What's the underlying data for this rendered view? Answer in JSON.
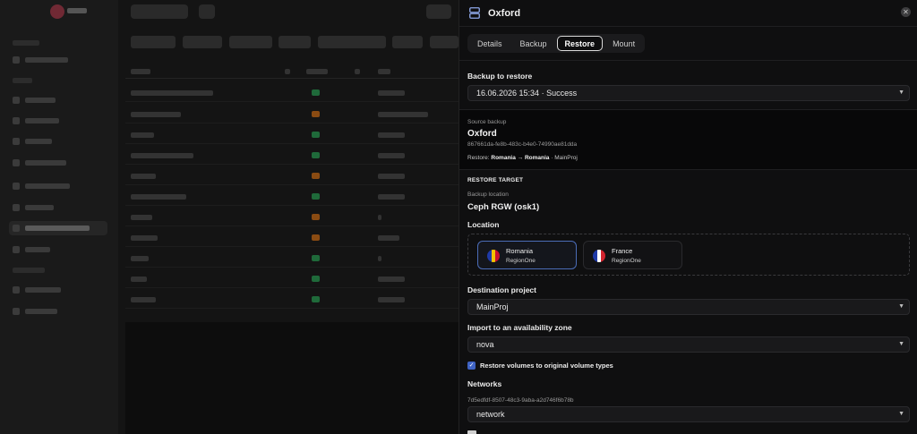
{
  "drawer": {
    "title": "Oxford",
    "close_icon": "close-icon",
    "tabs": [
      {
        "label": "Details",
        "active": false
      },
      {
        "label": "Backup",
        "active": false
      },
      {
        "label": "Restore",
        "active": true
      },
      {
        "label": "Mount",
        "active": false
      }
    ]
  },
  "backup_to_restore": {
    "label": "Backup to restore",
    "value": "16.06.2026 15:34 · Success"
  },
  "source": {
    "caption": "Source backup",
    "name": "Oxford",
    "id": "867661da-fe8b-483c-b4e0-74990ae81dda",
    "restore_prefix": "Restore:",
    "restore_from": "Romania",
    "arrow": "→",
    "restore_to": "Romania",
    "restore_project": "· MainProj"
  },
  "restore_target": {
    "section_title": "RESTORE TARGET",
    "backup_location_caption": "Backup location",
    "backup_location_value": "Ceph RGW (osk1)",
    "location_label": "Location",
    "regions": [
      {
        "name": "Romania",
        "sub": "RegionOne",
        "selected": true,
        "flag_colors": [
          "#1f3aa8",
          "#f2c300",
          "#c8102e"
        ]
      },
      {
        "name": "France",
        "sub": "RegionOne",
        "selected": false,
        "flag_colors": [
          "#1f3aa8",
          "#ffffff",
          "#d2242f"
        ]
      }
    ]
  },
  "destination_project": {
    "label": "Destination project",
    "value": "MainProj"
  },
  "availability_zone": {
    "label": "Import to an availability zone",
    "value": "nova"
  },
  "restore_volumes": {
    "label": "Restore volumes to original volume types",
    "checked": true
  },
  "networks": {
    "label": "Networks",
    "id": "7d5edfdf-8507-48c3-9aba-a2d746f6b78b",
    "value": "network"
  },
  "colors": {
    "accent": "#3f63c4",
    "selected_border": "#4b6cb7",
    "background": "#0f0f10"
  }
}
